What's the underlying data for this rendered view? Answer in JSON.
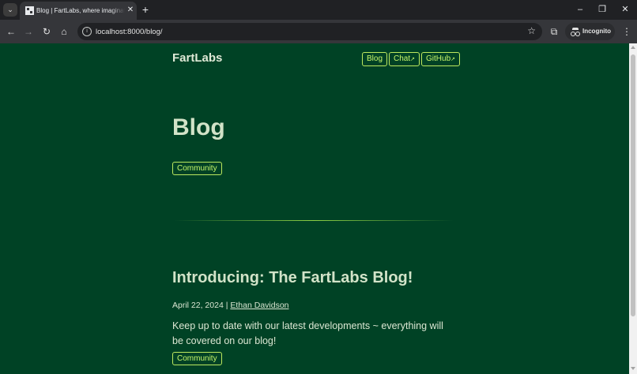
{
  "browser": {
    "tab_title": "Blog | FartLabs, where imagination",
    "url": "localhost:8000/blog/",
    "incognito_label": "Incognito"
  },
  "site": {
    "brand": "FartLabs",
    "nav": [
      {
        "label": "Blog"
      },
      {
        "label": "Chat",
        "ext": "↗"
      },
      {
        "label": "GitHub",
        "ext": "↗"
      }
    ]
  },
  "page": {
    "title": "Blog",
    "tags": [
      "Community"
    ]
  },
  "post": {
    "title": "Introducing: The FartLabs Blog!",
    "date": "April 22, 2024",
    "separator": "|",
    "author": "Ethan Davidson",
    "excerpt": "Keep up to date with our latest developments ~ everything will be covered on our blog!",
    "tags": [
      "Community"
    ]
  },
  "colors": {
    "page_background": "#004225",
    "accent": "#c8f56a",
    "heading": "#d2e3c8"
  }
}
